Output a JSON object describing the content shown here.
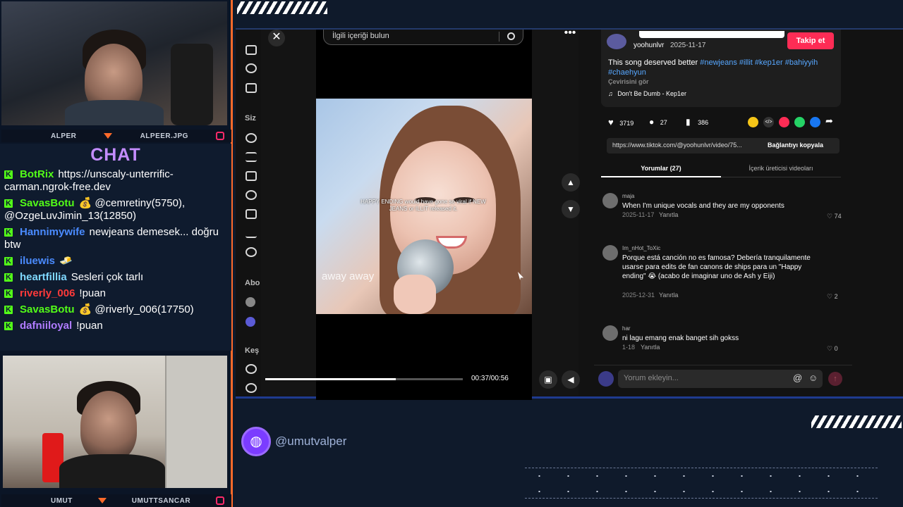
{
  "streamer_top": {
    "name": "ALPER",
    "handle": "ALPEER.JPG"
  },
  "streamer_bottom": {
    "name": "UMUT",
    "handle": "UMUTTSANCAR"
  },
  "chat": {
    "title": "CHAT",
    "messages": [
      {
        "user": "BotRix",
        "text": "https://unscaly-unterrific-carman.ngrok-free.dev",
        "color": "#53fc18"
      },
      {
        "user": "SavasBotu",
        "text": "💰 @cemretiny(5750), @OzgeLuvJimin_13(12850)",
        "color": "#53fc18"
      },
      {
        "user": "Hannimywife",
        "text": "newjeans demesek... doğru btw",
        "color": "#4a8bff"
      },
      {
        "user": "iluewis",
        "text": "🧈",
        "color": "#4a8bff"
      },
      {
        "user": "heartfillia",
        "text": "Sesleri çok tarlı",
        "color": "#7fd8ff"
      },
      {
        "user": "riverly_006",
        "text": "!puan",
        "color": "#ff3a3a"
      },
      {
        "user": "SavasBotu",
        "text": "💰 @riverly_006(17750)",
        "color": "#53fc18"
      },
      {
        "user": "dafniiloyal",
        "text": "!puan",
        "color": "#b07cff"
      }
    ]
  },
  "video": {
    "search_placeholder": "İlgili içeriği bulun",
    "caption_overlay": "HAPPY ENDING would have gone so viral if NEW JEANS or ILLIT released it.",
    "lyric_text": "away away",
    "time": "00:37/00:56",
    "progress": 0.66
  },
  "sidebar": {
    "label_1": "Siz",
    "label_2": "Abo",
    "label_3": "Keş"
  },
  "post": {
    "author": "yoohunlvr",
    "date": "2025-11-17",
    "follow_label": "Takip et",
    "description": "This song deserved better",
    "hashtags": "#newjeans #illit #kep1er #bahiyyih #chaehyun",
    "translate_label": "Çevirisini gör",
    "music": "Don't Be Dumb - Kep1er",
    "likes": "3719",
    "comments_count": "27",
    "saves": "386",
    "url": "https://www.tiktok.com/@yoohunlvr/video/75...",
    "copy_link_label": "Bağlantıyı kopyala"
  },
  "tabs": {
    "comments": "Yorumlar (27)",
    "creator_videos": "İçerik üreticisi videoları"
  },
  "comments": [
    {
      "user": "maja",
      "text": "When I'm unique vocals and they are my opponents",
      "date": "2025-11-17",
      "reply": "Yanıtla",
      "likes": "74"
    },
    {
      "user": "Im_nHot_ToXic",
      "text": "Porque está canción no es famosa? Debería tranquilamente usarse para edits de fan canons de ships para un \"Happy ending\" 😭 (acabo de imaginar uno de Ash y Eiji)",
      "date": "2025-12-31",
      "reply": "Yanıtla",
      "likes": "2"
    },
    {
      "user": "har",
      "text": "ni lagu emang enak banget sih gokss",
      "date": "1-18",
      "reply": "Yanıtla",
      "likes": "0"
    }
  ],
  "comment_input": {
    "placeholder": "Yorum ekleyin..."
  },
  "footer": {
    "handle": "@umutvalper"
  },
  "colors": {
    "accent": "#fe2c55",
    "kick_green": "#53fc18",
    "overlay_purple": "#7b3cff"
  }
}
